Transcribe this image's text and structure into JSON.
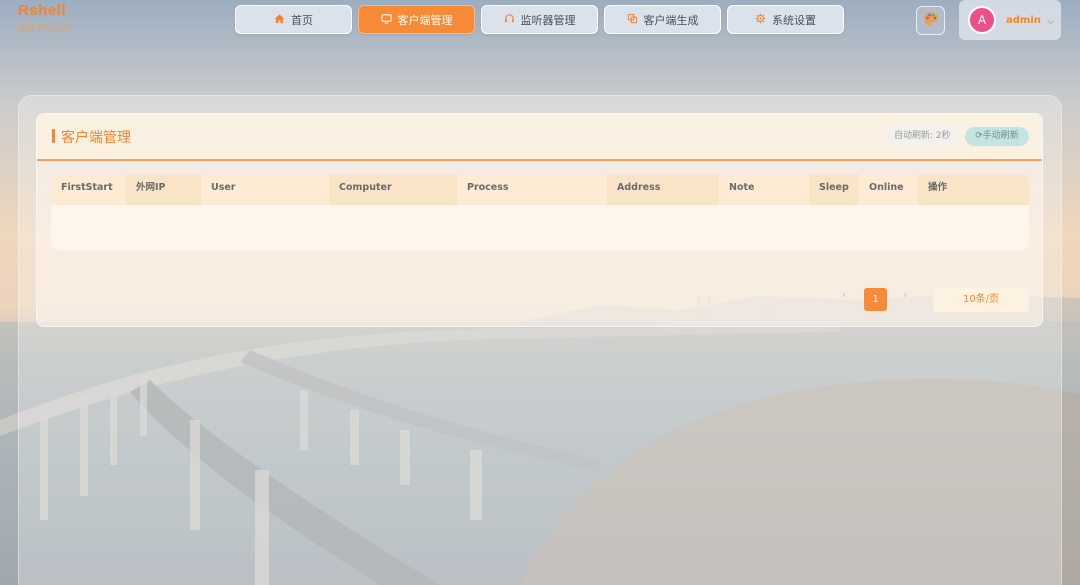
{
  "app": {
    "title": "Rshell",
    "subtitle": "高级管理系统"
  },
  "nav": {
    "items": [
      {
        "label": "首页",
        "icon": "home-icon",
        "active": false
      },
      {
        "label": "客户端管理",
        "icon": "monitor-icon",
        "active": true
      },
      {
        "label": "监听器管理",
        "icon": "headset-icon",
        "active": false
      },
      {
        "label": "客户端生成",
        "icon": "copy-icon",
        "active": false
      },
      {
        "label": "系统设置",
        "icon": "gear-icon",
        "active": false
      }
    ]
  },
  "theme": {
    "icon": "palette-icon"
  },
  "user": {
    "avatar_letter": "A",
    "name": "admin",
    "avatar_color": "#ec4f89"
  },
  "panel": {
    "title": "客户端管理",
    "auto_refresh": "自动刷新: 2秒",
    "manual_refresh": "⟳手动刷新"
  },
  "table": {
    "columns": [
      "FirstStart",
      "外网IP",
      "User",
      "Computer",
      "Process",
      "Address",
      "Note",
      "Sleep",
      "Online",
      "操作"
    ],
    "rows": []
  },
  "pagination": {
    "prev": "‹",
    "current": "1",
    "next": "›",
    "page_size": "10条/页"
  },
  "colors": {
    "accent": "#f68a36",
    "accent_text": "#f4852a"
  }
}
